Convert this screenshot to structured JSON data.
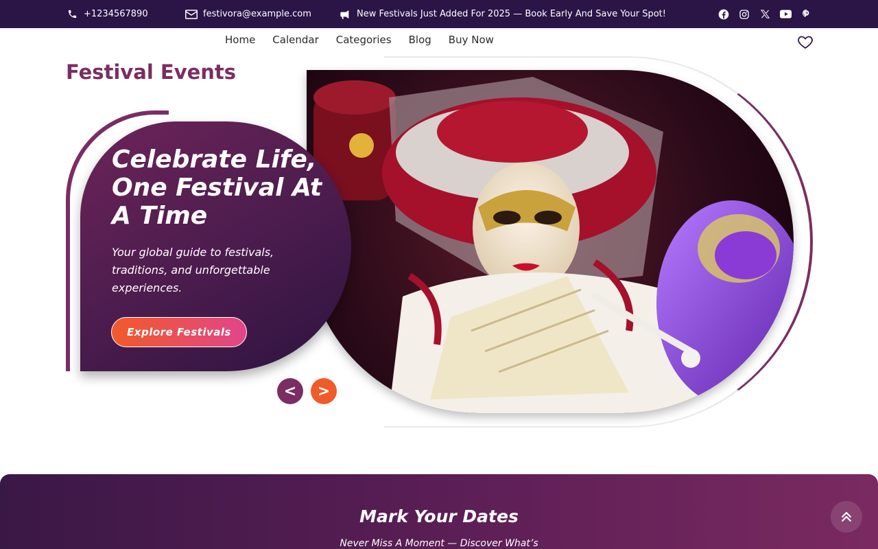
{
  "topbar": {
    "phone": "+1234567890",
    "email": "festivora@example.com",
    "announcement": "New Festivals Just Added For 2025 — Book Early And Save Your Spot!",
    "social_icons": [
      "facebook-icon",
      "instagram-icon",
      "x-icon",
      "youtube-icon",
      "pinterest-icon"
    ]
  },
  "nav": {
    "items": [
      {
        "label": "Home"
      },
      {
        "label": "Calendar"
      },
      {
        "label": "Categories"
      },
      {
        "label": "Blog"
      },
      {
        "label": "Buy Now"
      }
    ],
    "wishlist_icon": "heart-icon"
  },
  "hero": {
    "section_title": "Festival Events",
    "headline": "Celebrate Life, One Festival At A Time",
    "subtitle": "Your global guide to festivals, traditions, and unforgettable experiences.",
    "cta_label": "Explore Festivals",
    "prev_label": "<",
    "next_label": ">",
    "image_description": "Venetian carnival mask costume with fan"
  },
  "dates": {
    "title": "Mark Your Dates",
    "subtitle": "Never Miss A Moment — Discover What’s"
  },
  "colors": {
    "topbar_bg": "#2b1446",
    "brand_purple": "#7b2d63",
    "accent_orange": "#f15a29"
  }
}
